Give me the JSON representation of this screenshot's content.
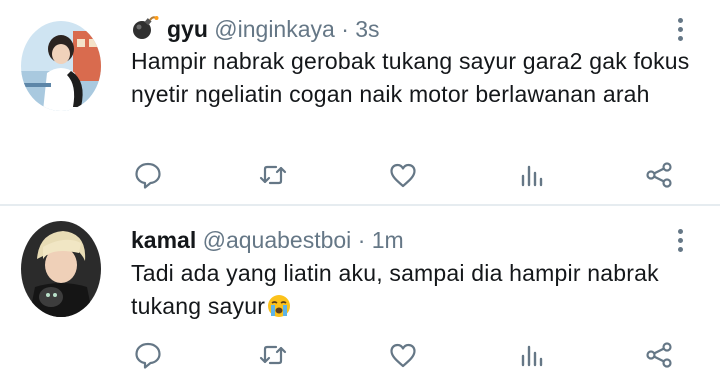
{
  "tweets": [
    {
      "display_name": "gyu",
      "handle": "@inginkaya",
      "separator": "·",
      "time": "3s",
      "text": "Hampir nabrak gerobak tukang sayur gara2 gak fokus nyetir ngeliatin cogan naik motor berlawanan arah",
      "name_emoji_icon": "bomb-icon",
      "colors": {
        "avatar_bg": "#cfe4f2",
        "shirt": "#ffffff"
      }
    },
    {
      "display_name": "kamal",
      "handle": "@aquabestboi",
      "separator": "·",
      "time": "1m",
      "text": "Tadi ada yang liatin aku, sampai dia hampir nabrak tukang sayur",
      "trailing_emoji_icon": "loudly-crying-face-icon",
      "colors": {
        "avatar_bg": "#2b2b2b",
        "hair": "#e8dcb5"
      }
    }
  ],
  "action_icons": [
    "reply-icon",
    "retweet-icon",
    "like-icon",
    "analytics-icon",
    "share-icon"
  ],
  "theme": {
    "text": "#14171a",
    "secondary": "#657786",
    "divider": "#e6ecf0",
    "background": "#ffffff"
  }
}
